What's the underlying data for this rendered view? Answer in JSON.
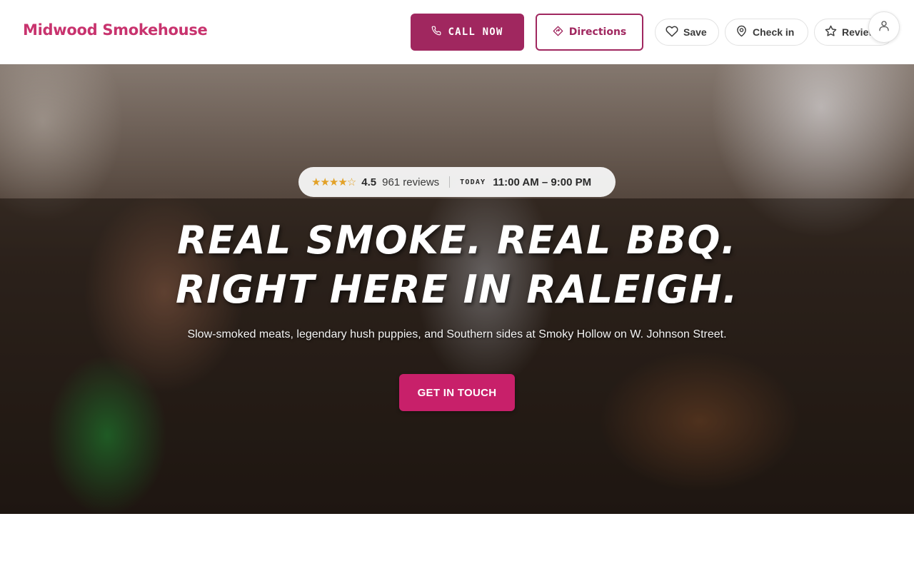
{
  "header": {
    "brand": "Midwood Smokehouse",
    "call_label": "CALL NOW",
    "directions_label": "Directions",
    "save_label": "Save",
    "checkin_label": "Check in",
    "review_label": "Review"
  },
  "hero": {
    "stars": "★★★★☆",
    "rating": "4.5",
    "reviews": "961 reviews",
    "today_label": "TODAY",
    "hours": "11:00 AM – 9:00 PM",
    "headline_line1": "REAL SMOKE. REAL BBQ.",
    "headline_line2": "RIGHT HERE IN RALEIGH.",
    "subtitle": "Slow-smoked meats, legendary hush puppies, and Southern sides at Smoky Hollow on W. Johnson Street.",
    "cta_label": "GET IN TOUCH"
  },
  "icons": {
    "call": "phone-icon",
    "directions": "directions-icon",
    "save": "heart-icon",
    "checkin": "map-pin-icon",
    "review": "star-icon",
    "account": "user-icon"
  },
  "colors": {
    "brand": "#c8336e",
    "primary": "#a0275f",
    "cta": "#c8206a",
    "star": "#e2a126"
  }
}
